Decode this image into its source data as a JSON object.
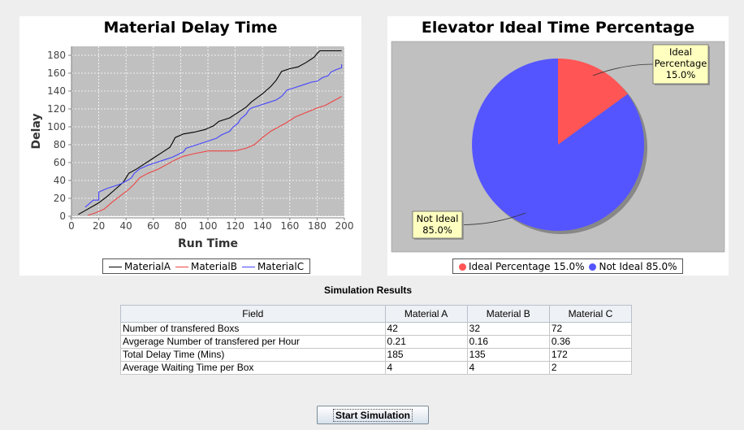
{
  "line_chart": {
    "title": "Material Delay Time",
    "xlabel": "Run Time",
    "ylabel": "Delay"
  },
  "pie_chart": {
    "title": "Elevator Ideal Time Percentage"
  },
  "chart_data": [
    {
      "type": "line",
      "title": "Material Delay Time",
      "xlabel": "Run Time",
      "ylabel": "Delay",
      "xlim": [
        0,
        200
      ],
      "ylim": [
        0,
        190
      ],
      "xticks": [
        0,
        20,
        40,
        60,
        80,
        100,
        120,
        140,
        160,
        180,
        200
      ],
      "yticks": [
        0,
        20,
        40,
        60,
        80,
        100,
        120,
        140,
        160,
        180
      ],
      "grid": true,
      "legend": "bottom",
      "series": [
        {
          "name": "MaterialA",
          "color": "#000000",
          "points": [
            [
              5,
              2
            ],
            [
              12,
              8
            ],
            [
              20,
              15
            ],
            [
              26,
              22
            ],
            [
              32,
              30
            ],
            [
              38,
              38
            ],
            [
              42,
              48
            ],
            [
              48,
              53
            ],
            [
              54,
              59
            ],
            [
              60,
              65
            ],
            [
              66,
              71
            ],
            [
              72,
              77
            ],
            [
              74,
              82
            ],
            [
              76,
              88
            ],
            [
              82,
              92
            ],
            [
              90,
              94
            ],
            [
              98,
              97
            ],
            [
              104,
              101
            ],
            [
              108,
              106
            ],
            [
              116,
              110
            ],
            [
              122,
              116
            ],
            [
              128,
              122
            ],
            [
              132,
              128
            ],
            [
              140,
              137
            ],
            [
              146,
              145
            ],
            [
              150,
              152
            ],
            [
              154,
              162
            ],
            [
              160,
              165
            ],
            [
              166,
              167
            ],
            [
              172,
              172
            ],
            [
              178,
              178
            ],
            [
              180,
              182
            ],
            [
              182,
              185
            ],
            [
              190,
              185
            ],
            [
              198,
              185
            ]
          ]
        },
        {
          "name": "MaterialB",
          "color": "#ee4444",
          "points": [
            [
              12,
              1
            ],
            [
              18,
              4
            ],
            [
              24,
              8
            ],
            [
              30,
              16
            ],
            [
              36,
              23
            ],
            [
              42,
              30
            ],
            [
              46,
              36
            ],
            [
              50,
              43
            ],
            [
              56,
              48
            ],
            [
              64,
              53
            ],
            [
              70,
              58
            ],
            [
              76,
              63
            ],
            [
              82,
              67
            ],
            [
              90,
              70
            ],
            [
              100,
              73
            ],
            [
              110,
              73
            ],
            [
              120,
              73
            ],
            [
              128,
              76
            ],
            [
              134,
              80
            ],
            [
              140,
              88
            ],
            [
              146,
              95
            ],
            [
              152,
              100
            ],
            [
              158,
              105
            ],
            [
              164,
              111
            ],
            [
              172,
              116
            ],
            [
              180,
              121
            ],
            [
              186,
              124
            ],
            [
              192,
              129
            ],
            [
              198,
              134
            ]
          ]
        },
        {
          "name": "MaterialC",
          "color": "#4444ff",
          "points": [
            [
              10,
              10
            ],
            [
              16,
              18
            ],
            [
              20,
              18
            ],
            [
              20,
              27
            ],
            [
              26,
              31
            ],
            [
              32,
              34
            ],
            [
              36,
              36
            ],
            [
              42,
              41
            ],
            [
              44,
              43
            ],
            [
              46,
              48
            ],
            [
              50,
              53
            ],
            [
              56,
              57
            ],
            [
              62,
              60
            ],
            [
              68,
              63
            ],
            [
              74,
              66
            ],
            [
              78,
              69
            ],
            [
              82,
              72
            ],
            [
              84,
              76
            ],
            [
              92,
              80
            ],
            [
              100,
              84
            ],
            [
              106,
              87
            ],
            [
              110,
              91
            ],
            [
              116,
              95
            ],
            [
              118,
              99
            ],
            [
              122,
              104
            ],
            [
              124,
              109
            ],
            [
              128,
              114
            ],
            [
              130,
              119
            ],
            [
              132,
              121
            ],
            [
              138,
              124
            ],
            [
              144,
              127
            ],
            [
              150,
              130
            ],
            [
              154,
              134
            ],
            [
              158,
              141
            ],
            [
              164,
              144
            ],
            [
              170,
              147
            ],
            [
              176,
              150
            ],
            [
              180,
              151
            ],
            [
              184,
              155
            ],
            [
              188,
              157
            ],
            [
              190,
              161
            ],
            [
              194,
              164
            ],
            [
              198,
              166
            ],
            [
              198,
              170
            ]
          ]
        }
      ]
    },
    {
      "type": "pie",
      "title": "Elevator Ideal Time Percentage",
      "legend": "bottom",
      "slices": [
        {
          "name": "Ideal Percentage",
          "value": 15.0,
          "color": "#ff5555",
          "label_lines": [
            "Ideal",
            "Percentage",
            "15.0%"
          ],
          "legend_label": "Ideal Percentage 15.0%"
        },
        {
          "name": "Not Ideal",
          "value": 85.0,
          "color": "#5555ff",
          "label_lines": [
            "Not Ideal",
            "85.0%"
          ],
          "legend_label": "Not Ideal 85.0%"
        }
      ]
    }
  ],
  "results": {
    "title": "Simulation Results",
    "columns": [
      "Field",
      "Material A",
      "Material B",
      "Material C"
    ],
    "rows": [
      [
        "Number of transfered Boxs",
        "42",
        "32",
        "72"
      ],
      [
        "Avgerage Number of transfered per Hour",
        "0.21",
        "0.16",
        "0.36"
      ],
      [
        "Total Delay Time (Mins)",
        "185",
        "135",
        "172"
      ],
      [
        "Average Waiting Time per Box",
        "4",
        "4",
        "2"
      ]
    ]
  },
  "controls": {
    "start_label": "Start Simulation"
  }
}
